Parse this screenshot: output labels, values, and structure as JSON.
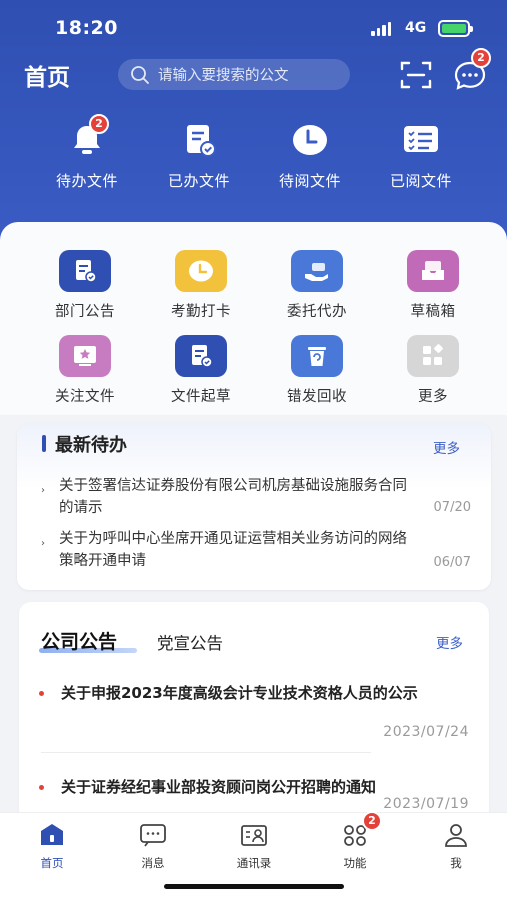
{
  "status_bar": {
    "time": "18:20",
    "network": "4G"
  },
  "header": {
    "title": "首页",
    "search_placeholder": "请输入要搜索的公文",
    "chat_badge": "2"
  },
  "top_nav": [
    {
      "label": "待办文件",
      "icon": "bell-icon",
      "badge": "2"
    },
    {
      "label": "已办文件",
      "icon": "document-check-icon"
    },
    {
      "label": "待阅文件",
      "icon": "clock-icon"
    },
    {
      "label": "已阅文件",
      "icon": "checklist-icon"
    }
  ],
  "functions": [
    {
      "label": "部门公告",
      "icon": "document-check-icon",
      "color": "#2f4fb2"
    },
    {
      "label": "考勤打卡",
      "icon": "clock-icon",
      "color": "#f2c23d"
    },
    {
      "label": "委托代办",
      "icon": "hand-icon",
      "color": "#4a78d8"
    },
    {
      "label": "草稿箱",
      "icon": "inbox-icon",
      "color": "#c06ab8"
    },
    {
      "label": "关注文件",
      "icon": "star-icon",
      "color": "#c77bc0"
    },
    {
      "label": "文件起草",
      "icon": "document-check-icon",
      "color": "#2f4fb2"
    },
    {
      "label": "错发回收",
      "icon": "recycle-bin-icon",
      "color": "#4a78d8"
    },
    {
      "label": "更多",
      "icon": "grid-icon",
      "color": "#c9c9c9"
    }
  ],
  "todo": {
    "title": "最新待办",
    "more": "更多",
    "items": [
      {
        "text": "关于签署信达证券股份有限公司机房基础设施服务合同的请示",
        "date": "07/20"
      },
      {
        "text": "关于为呼叫中心坐席开通见证运营相关业务访问的网络策略开通申请",
        "date": "06/07"
      }
    ]
  },
  "notice": {
    "tab_active": "公司公告",
    "tab_other": "党宣公告",
    "more": "更多",
    "items": [
      {
        "text": "关于申报2023年度高级会计专业技术资格人员的公示",
        "date": "2023/07/24"
      },
      {
        "text": "关于证券经纪事业部投资顾问岗公开招聘的通知",
        "date": "2023/07/19"
      }
    ]
  },
  "tab_bar": [
    {
      "label": "首页",
      "icon": "home-icon",
      "active": true
    },
    {
      "label": "消息",
      "icon": "message-icon"
    },
    {
      "label": "通讯录",
      "icon": "contacts-icon"
    },
    {
      "label": "功能",
      "icon": "apps-icon",
      "badge": "2"
    },
    {
      "label": "我",
      "icon": "user-icon"
    }
  ]
}
